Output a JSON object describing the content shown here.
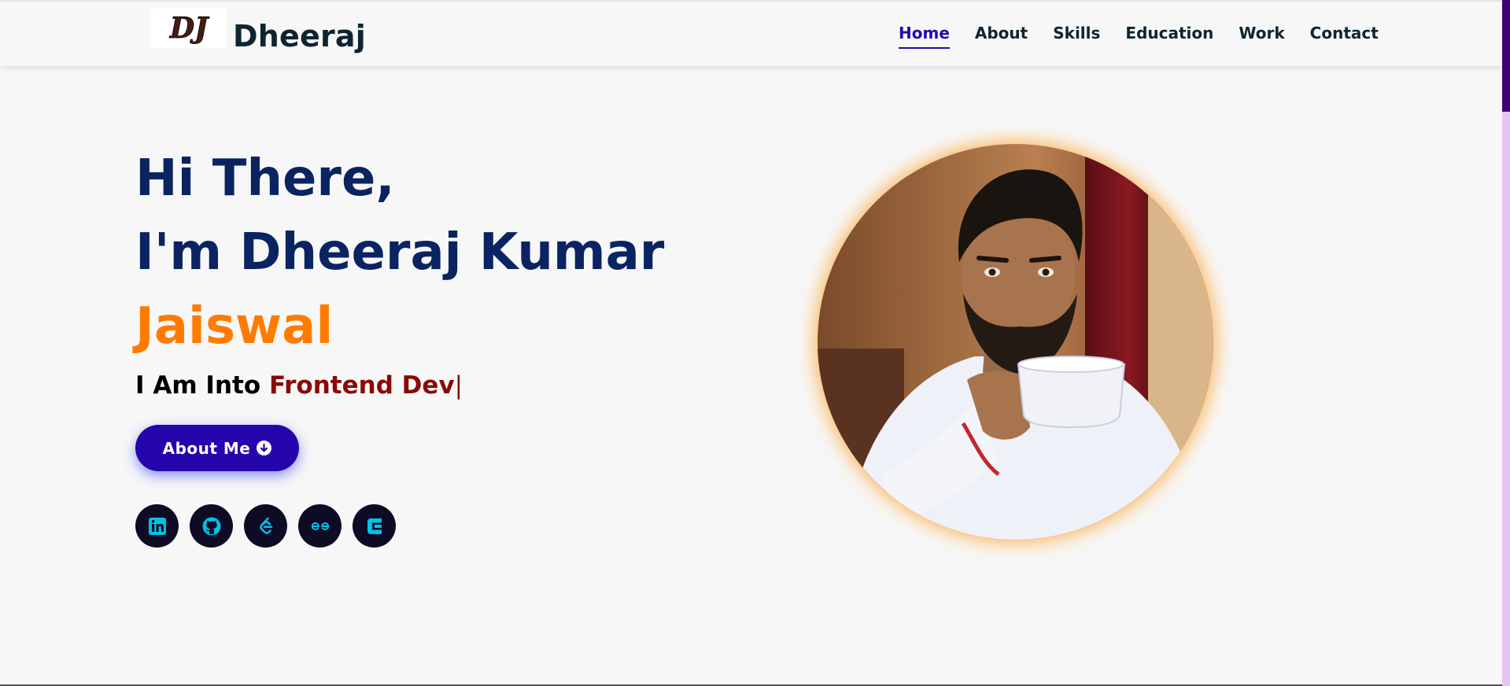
{
  "header": {
    "brand": "Dheeraj",
    "logo_text": "DJ",
    "nav": [
      {
        "label": "Home",
        "active": true
      },
      {
        "label": "About"
      },
      {
        "label": "Skills"
      },
      {
        "label": "Education"
      },
      {
        "label": "Work"
      },
      {
        "label": "Contact"
      }
    ]
  },
  "hero": {
    "line1": "Hi There,",
    "line2": "I'm Dheeraj Kumar",
    "line3": "Jaiswal",
    "typed_prefix": "I Am Into ",
    "typed_role": "Frontend Dev",
    "typed_caret": "|",
    "button_label": "About Me",
    "button_icon": "arrow-circle-down-icon",
    "socials": [
      {
        "name": "linkedin-icon"
      },
      {
        "name": "github-icon"
      },
      {
        "name": "leetcode-icon"
      },
      {
        "name": "geeksforgeeks-icon"
      },
      {
        "name": "codechef-icon"
      }
    ],
    "photo_alt": "profile-photo"
  },
  "colors": {
    "primary": "#2506ad",
    "heading": "#0a2462",
    "accent": "#ff7b00",
    "role": "#8a0808",
    "social_bg": "#0e0b24",
    "social_icon": "#00c2e8",
    "scroll_thumb": "#420177"
  }
}
